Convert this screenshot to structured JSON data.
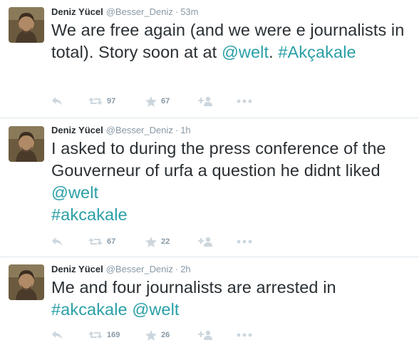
{
  "tweets": [
    {
      "name": "Deniz Yücel",
      "handle": "@Besser_Deniz",
      "separator": "·",
      "time": "53m",
      "text_segments": [
        {
          "text": "We are free again  (and we were e journalists in total). Story soon at at ",
          "link": false
        },
        {
          "text": "@welt",
          "link": true
        },
        {
          "text": ". ",
          "link": false
        },
        {
          "text": "#Akçakale",
          "link": true
        }
      ],
      "retweets": "97",
      "favorites": "67"
    },
    {
      "name": "Deniz Yücel",
      "handle": "@Besser_Deniz",
      "separator": "·",
      "time": "1h",
      "text_segments": [
        {
          "text": "I asked to during the press conference of the Gouverneur of urfa a question he didnt liked ",
          "link": false
        },
        {
          "text": "@welt",
          "link": true
        },
        {
          "text": "\n",
          "link": false
        },
        {
          "text": "#akcakale",
          "link": true
        }
      ],
      "retweets": "67",
      "favorites": "22"
    },
    {
      "name": "Deniz Yücel",
      "handle": "@Besser_Deniz",
      "separator": "·",
      "time": "2h",
      "text_segments": [
        {
          "text": "Me and four journalists are arrested in ",
          "link": false
        },
        {
          "text": "#akcakale",
          "link": true
        },
        {
          "text": " ",
          "link": false
        },
        {
          "text": "@welt",
          "link": true
        }
      ],
      "retweets": "169",
      "favorites": "26"
    }
  ],
  "icons": {
    "reply": "reply-icon",
    "retweet": "retweet-icon",
    "favorite": "star-icon",
    "follow": "add-user-icon",
    "more": "more-icon"
  },
  "colors": {
    "link": "#2a9fa6",
    "muted": "#8899a6",
    "action_icon": "#ccd6dd",
    "text": "#292f33",
    "divider": "#e1e8ed"
  }
}
